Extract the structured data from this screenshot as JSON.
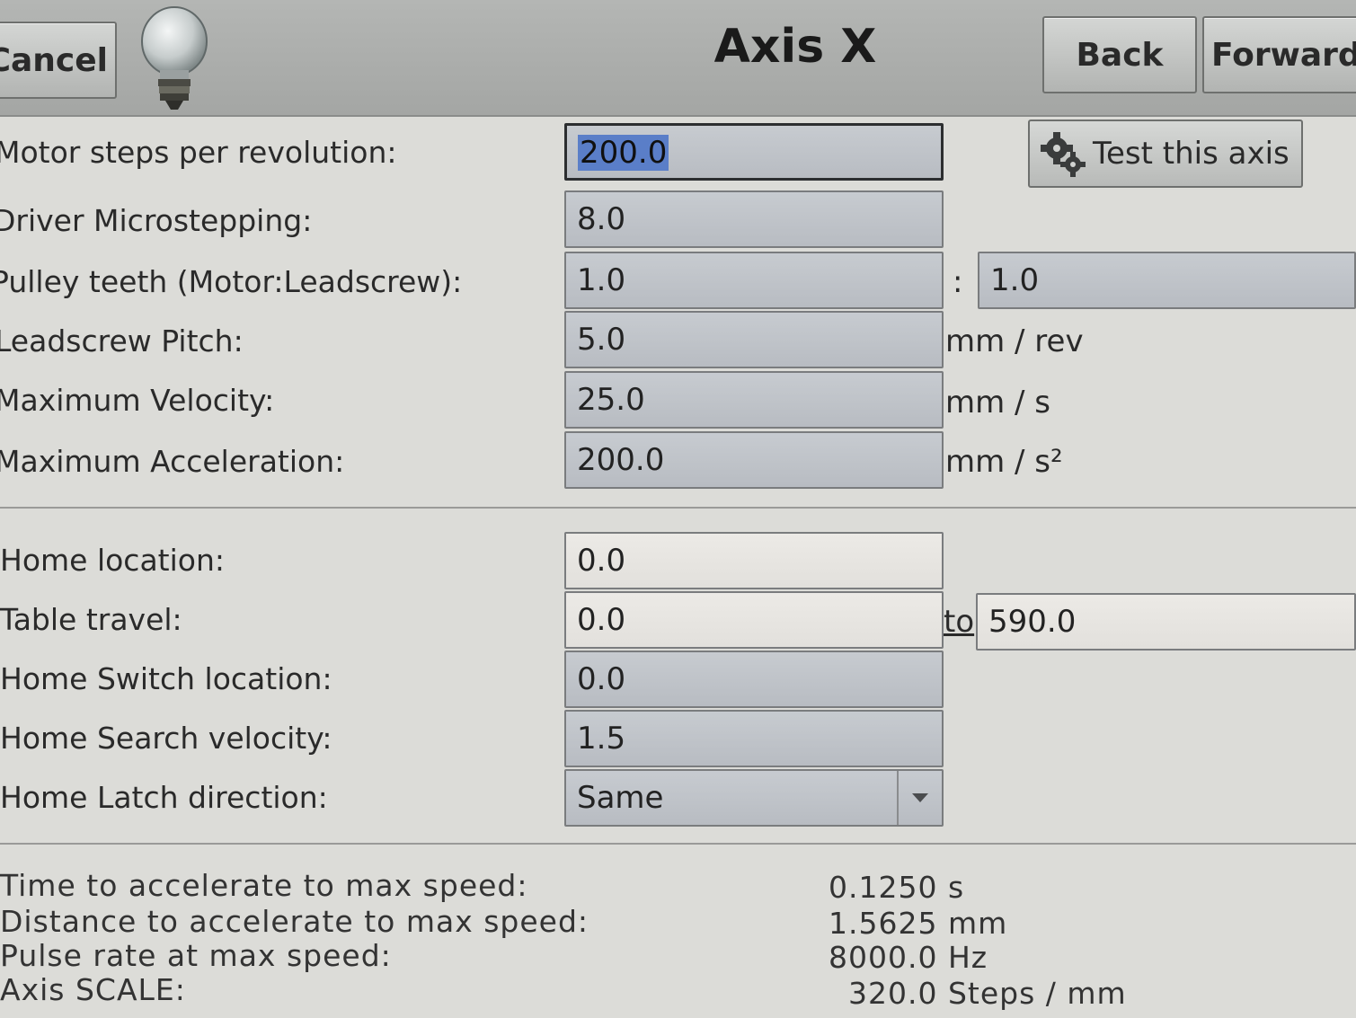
{
  "header": {
    "cancel_label": "Cancel",
    "title": "Axis X",
    "back_label": "Back",
    "forward_label": "Forward",
    "bulb_icon": "lightbulb-icon"
  },
  "test_button": {
    "label": "Test this axis",
    "icon": "gears-icon"
  },
  "motor": {
    "steps_label": "Motor steps per revolution:",
    "steps_value": "200.0",
    "microstep_label": "Driver Microstepping:",
    "microstep_value": "8.0",
    "pulley_label": "Pulley teeth (Motor:Leadscrew):",
    "pulley_motor_value": "1.0",
    "pulley_sep": ":",
    "pulley_leadscrew_value": "1.0",
    "pitch_label": "Leadscrew Pitch:",
    "pitch_value": "5.0",
    "pitch_unit": "mm / rev",
    "velocity_label": "Maximum Velocity:",
    "velocity_value": "25.0",
    "velocity_unit": "mm / s",
    "accel_label": "Maximum Acceleration:",
    "accel_value": "200.0",
    "accel_unit": "mm / s²"
  },
  "home": {
    "location_label": "Home location:",
    "location_value": "0.0",
    "travel_label": "Table travel:",
    "travel_from": "0.0",
    "travel_to_label": "to",
    "travel_to": "590.0",
    "switch_label": "Home Switch location:",
    "switch_value": "0.0",
    "search_label": "Home Search velocity:",
    "search_value": "1.5",
    "latch_label": "Home Latch direction:",
    "latch_value": "Same"
  },
  "info": {
    "time_label": "Time to accelerate to max speed:",
    "time_value": "0.1250 s",
    "distance_label": "Distance to accelerate to max speed:",
    "distance_value": "1.5625 mm",
    "pulse_label": "Pulse rate at max speed:",
    "pulse_value": "8000.0 Hz",
    "scale_label": "Axis SCALE:",
    "scale_value": "320.0 Steps / mm"
  },
  "colors": {
    "header": "#a8aaa8",
    "field_bg": "#bfc3c8",
    "selection": "#5a7ec8",
    "background": "#dcdcd8"
  }
}
